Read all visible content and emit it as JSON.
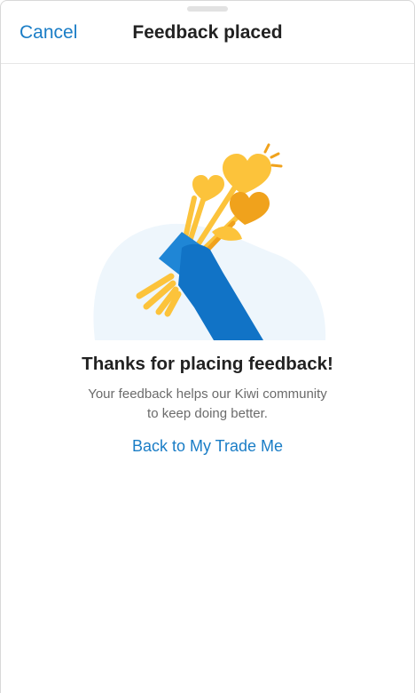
{
  "header": {
    "cancel_label": "Cancel",
    "title": "Feedback placed"
  },
  "confirmation": {
    "heading": "Thanks for placing feedback!",
    "message_line1": "Your feedback helps our Kiwi community",
    "message_line2": "to keep doing better.",
    "link_label": "Back to My Trade Me"
  },
  "illustration": {
    "icon": "hand-holding-hearts-icon"
  },
  "colors": {
    "accent": "#1a7dc6",
    "blob": "#eef6fc",
    "sleeve": "#1f86d6",
    "hand": "#1173c6",
    "heart_light": "#fcc33b",
    "heart_dark": "#f0a21c",
    "heading": "#222222",
    "body": "#6b6b6b"
  }
}
